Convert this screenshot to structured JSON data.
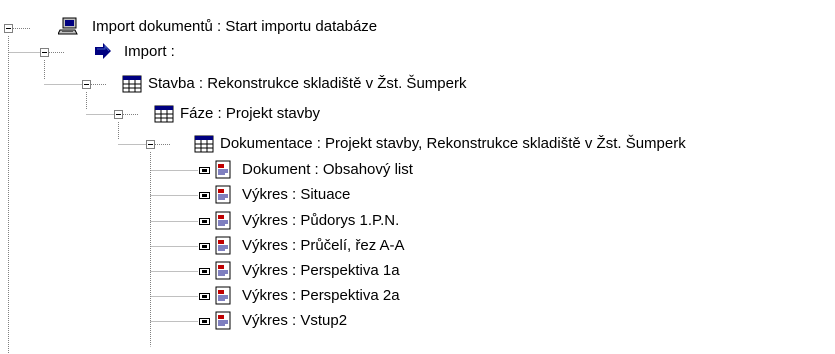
{
  "tree": {
    "root": {
      "label": "Import dokumentů : Start importu databáze",
      "icon": "computer-icon",
      "children": [
        {
          "label": "Import :",
          "icon": "arrow-right-icon",
          "children": [
            {
              "label": "Stavba : Rekonstrukce skladiště v Žst. Šumperk",
              "icon": "table-icon",
              "children": [
                {
                  "label": "Fáze : Projekt stavby",
                  "icon": "table-icon",
                  "children": [
                    {
                      "label": "Dokumentace : Projekt stavby, Rekonstrukce skladiště v Žst. Šumperk",
                      "icon": "table-icon",
                      "items": [
                        {
                          "label": "Dokument : Obsahový list",
                          "icon": "document-icon"
                        },
                        {
                          "label": "Výkres : Situace",
                          "icon": "document-icon"
                        },
                        {
                          "label": "Výkres : Půdorys 1.P.N.",
                          "icon": "document-icon"
                        },
                        {
                          "label": "Výkres : Průčelí, řez A-A",
                          "icon": "document-icon"
                        },
                        {
                          "label": "Výkres : Perspektiva 1a",
                          "icon": "document-icon"
                        },
                        {
                          "label": "Výkres : Perspektiva 2a",
                          "icon": "document-icon"
                        },
                        {
                          "label": "Výkres : Vstup2",
                          "icon": "document-icon"
                        }
                      ]
                    }
                  ]
                }
              ]
            }
          ]
        }
      ]
    }
  }
}
